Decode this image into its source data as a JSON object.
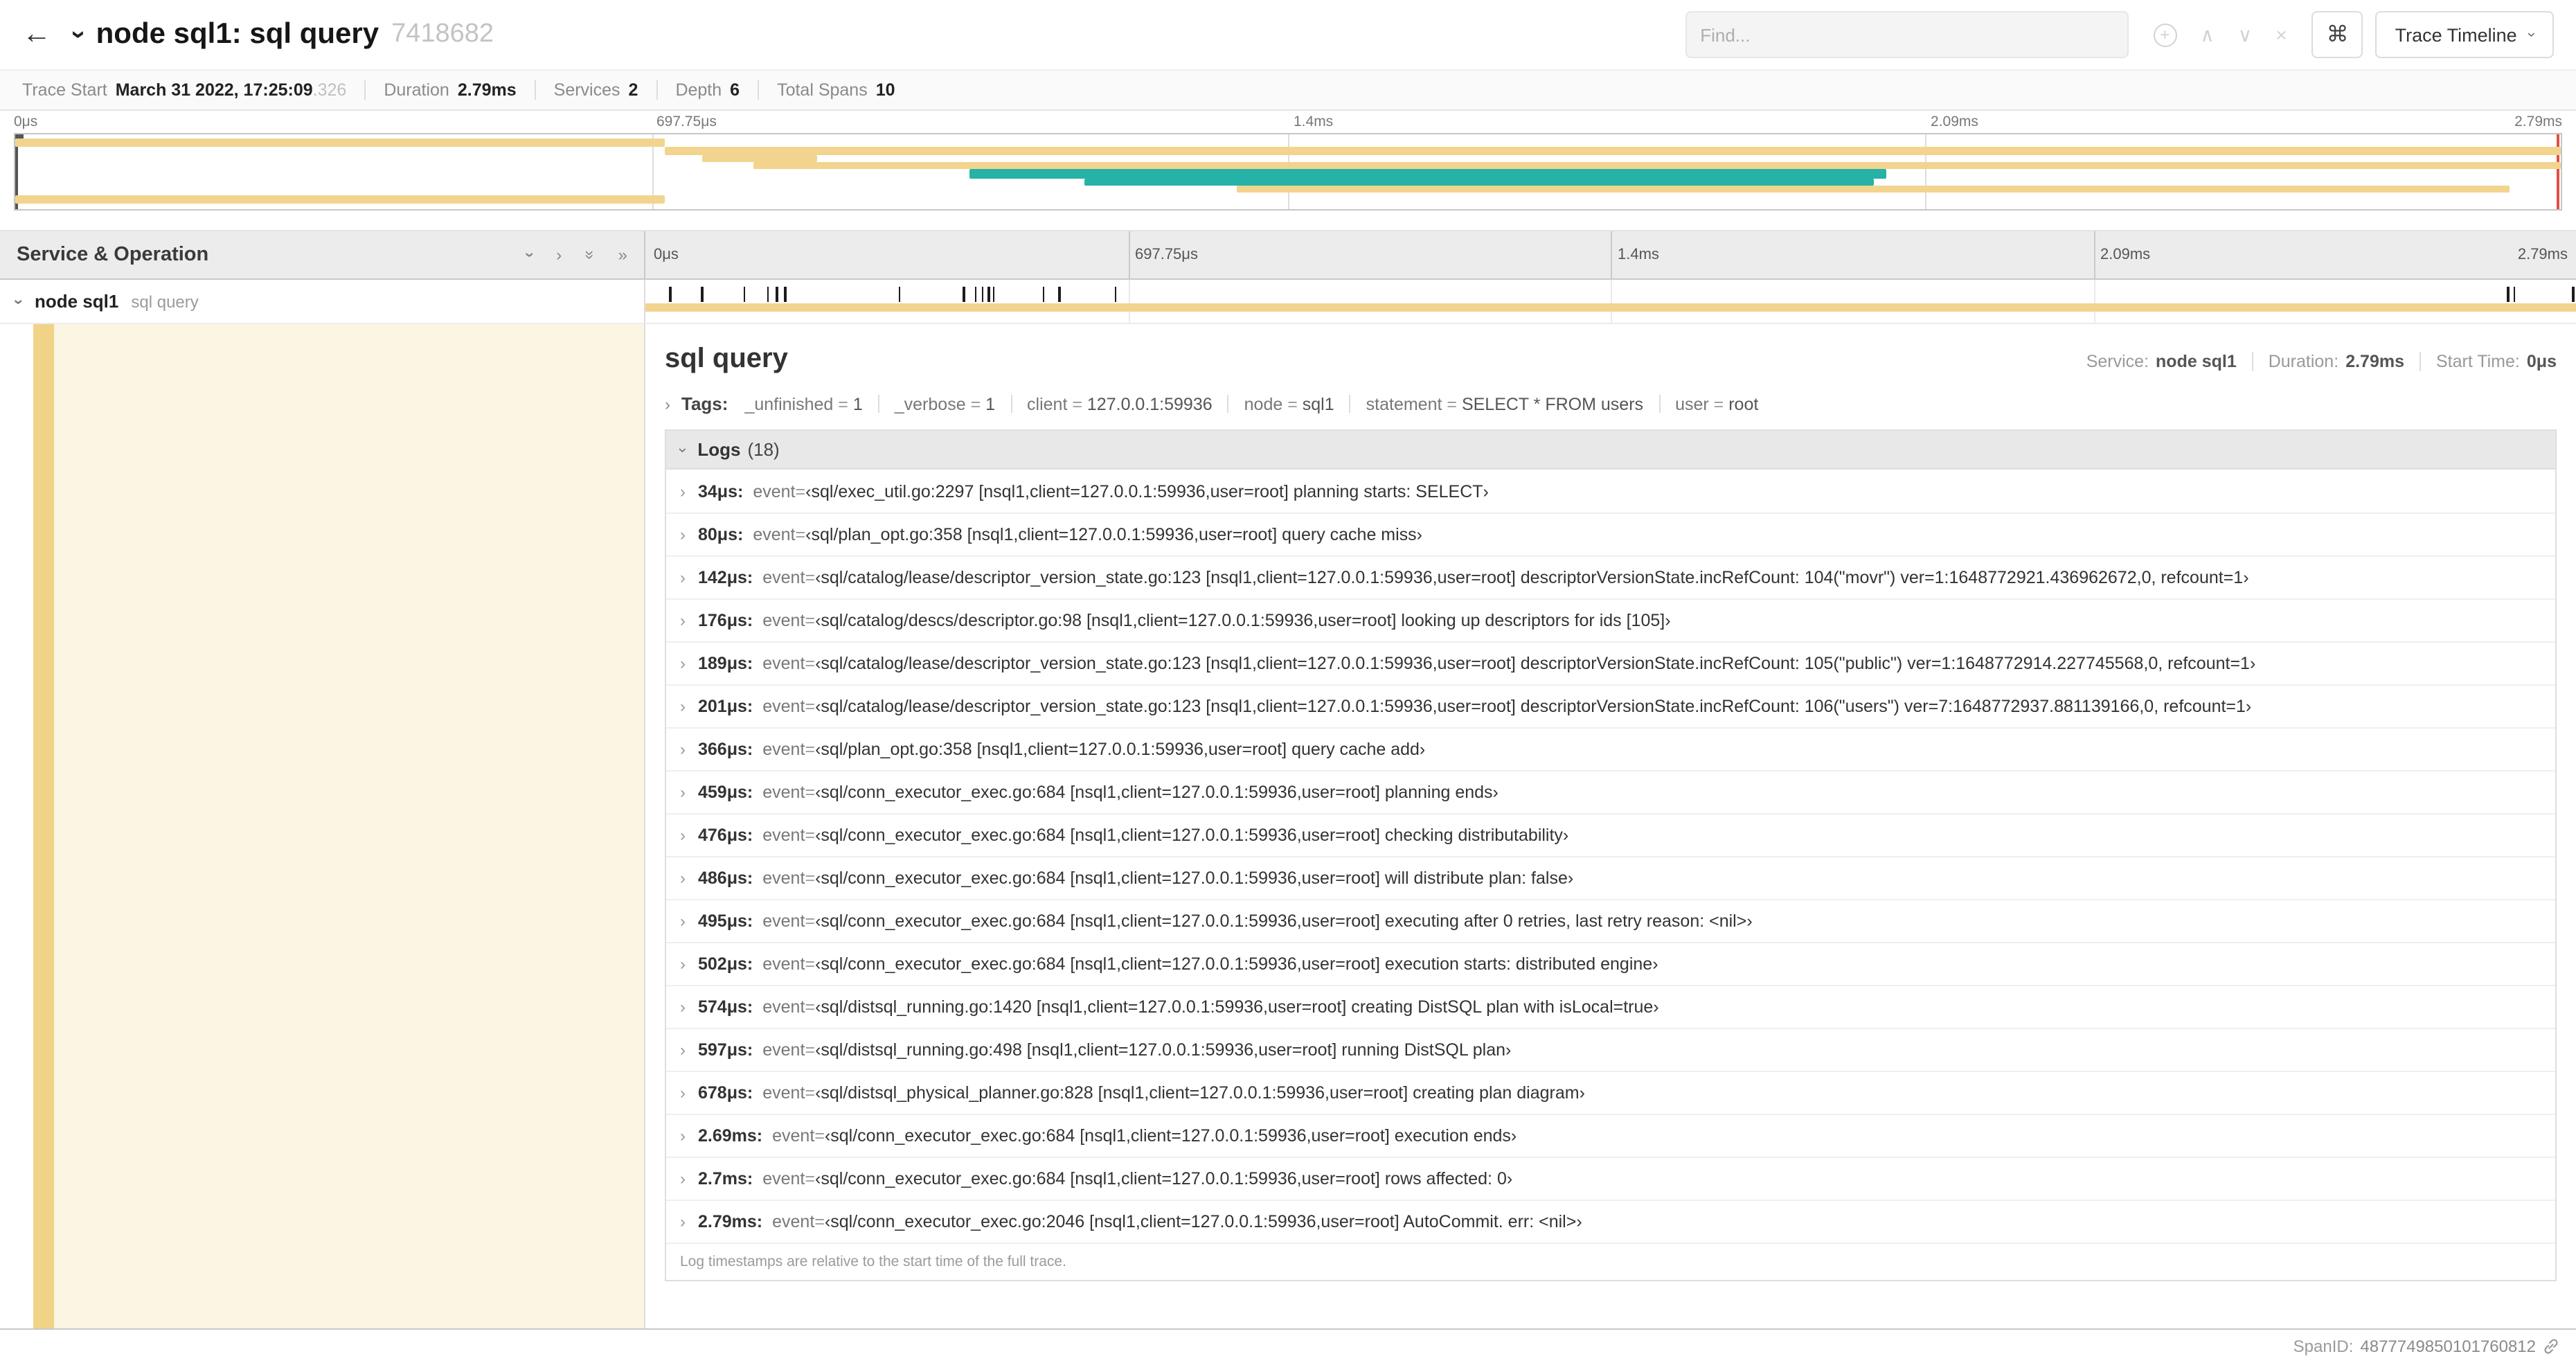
{
  "colors": {
    "tan": "#f2d48f",
    "teal": "#26b2a6",
    "stripe": "#f0d387",
    "cream": "#fbf5e3",
    "red": "#e25041"
  },
  "header": {
    "title": "node sql1: sql query",
    "trace_id": "7418682",
    "find_placeholder": "Find...",
    "trace_timeline_label": "Trace Timeline"
  },
  "summary": {
    "items": [
      {
        "label": "Trace Start",
        "value": "March 31 2022, 17:25:09",
        "suffix": ".326"
      },
      {
        "label": "Duration",
        "value": "2.79ms"
      },
      {
        "label": "Services",
        "value": "2"
      },
      {
        "label": "Depth",
        "value": "6"
      },
      {
        "label": "Total Spans",
        "value": "10"
      }
    ]
  },
  "minimap": {
    "ticks": [
      "0μs",
      "697.75μs",
      "1.4ms",
      "2.09ms",
      "2.79ms"
    ],
    "bars": [
      {
        "l": 0,
        "w": 25.5,
        "t": 3,
        "h": 6,
        "c": "tan"
      },
      {
        "l": 25.5,
        "w": 74.5,
        "t": 9,
        "h": 6,
        "c": "tan"
      },
      {
        "l": 27,
        "w": 4.5,
        "t": 15,
        "h": 5,
        "c": "tan"
      },
      {
        "l": 29,
        "w": 71,
        "t": 20,
        "h": 5,
        "c": "tan"
      },
      {
        "l": 37.5,
        "w": 36,
        "t": 25,
        "h": 7,
        "c": "teal"
      },
      {
        "l": 42,
        "w": 31,
        "t": 32,
        "h": 5,
        "c": "teal"
      },
      {
        "l": 48,
        "w": 50,
        "t": 37,
        "h": 5,
        "c": "tan"
      },
      {
        "l": 0,
        "w": 25.5,
        "t": 44,
        "h": 6,
        "c": "tan"
      }
    ]
  },
  "timeline": {
    "left_header": "Service & Operation",
    "ticks": [
      "0μs",
      "697.75μs",
      "1.4ms",
      "2.09ms",
      "2.79ms"
    ],
    "row": {
      "service": "node sql1",
      "operation": "sql query",
      "log_tick_percents": [
        1.22,
        2.87,
        5.09,
        6.31,
        6.77,
        7.2,
        13.12,
        16.45,
        17.06,
        17.42,
        17.74,
        17.99,
        20.57,
        21.4,
        24.3,
        96.42,
        96.77,
        99.8
      ]
    }
  },
  "detail": {
    "title": "sql query",
    "service_label": "Service:",
    "service": "node sql1",
    "duration_label": "Duration:",
    "duration": "2.79ms",
    "start_label": "Start Time:",
    "start": "0μs",
    "tags_label": "Tags:",
    "tags": [
      {
        "key": "_unfinished",
        "value": "1"
      },
      {
        "key": "_verbose",
        "value": "1"
      },
      {
        "key": "client",
        "value": "127.0.0.1:59936"
      },
      {
        "key": "node",
        "value": "sql1"
      },
      {
        "key": "statement",
        "value": "SELECT * FROM users"
      },
      {
        "key": "user",
        "value": "root"
      }
    ],
    "logs_label": "Logs",
    "logs_count": "(18)",
    "logs": [
      {
        "time": "34μs:",
        "key": "event",
        "value": "‹sql/exec_util.go:2297 [nsql1,client=127.0.0.1:59936,user=root] planning starts: SELECT›"
      },
      {
        "time": "80μs:",
        "key": "event",
        "value": "‹sql/plan_opt.go:358 [nsql1,client=127.0.0.1:59936,user=root] query cache miss›"
      },
      {
        "time": "142μs:",
        "key": "event",
        "value": "‹sql/catalog/lease/descriptor_version_state.go:123 [nsql1,client=127.0.0.1:59936,user=root] descriptorVersionState.incRefCount: 104(\"movr\") ver=1:1648772921.436962672,0, refcount=1›"
      },
      {
        "time": "176μs:",
        "key": "event",
        "value": "‹sql/catalog/descs/descriptor.go:98 [nsql1,client=127.0.0.1:59936,user=root] looking up descriptors for ids [105]›"
      },
      {
        "time": "189μs:",
        "key": "event",
        "value": "‹sql/catalog/lease/descriptor_version_state.go:123 [nsql1,client=127.0.0.1:59936,user=root] descriptorVersionState.incRefCount: 105(\"public\") ver=1:1648772914.227745568,0, refcount=1›"
      },
      {
        "time": "201μs:",
        "key": "event",
        "value": "‹sql/catalog/lease/descriptor_version_state.go:123 [nsql1,client=127.0.0.1:59936,user=root] descriptorVersionState.incRefCount: 106(\"users\") ver=7:1648772937.881139166,0, refcount=1›"
      },
      {
        "time": "366μs:",
        "key": "event",
        "value": "‹sql/plan_opt.go:358 [nsql1,client=127.0.0.1:59936,user=root] query cache add›"
      },
      {
        "time": "459μs:",
        "key": "event",
        "value": "‹sql/conn_executor_exec.go:684 [nsql1,client=127.0.0.1:59936,user=root] planning ends›"
      },
      {
        "time": "476μs:",
        "key": "event",
        "value": "‹sql/conn_executor_exec.go:684 [nsql1,client=127.0.0.1:59936,user=root] checking distributability›"
      },
      {
        "time": "486μs:",
        "key": "event",
        "value": "‹sql/conn_executor_exec.go:684 [nsql1,client=127.0.0.1:59936,user=root] will distribute plan: false›"
      },
      {
        "time": "495μs:",
        "key": "event",
        "value": "‹sql/conn_executor_exec.go:684 [nsql1,client=127.0.0.1:59936,user=root] executing after 0 retries, last retry reason: <nil>›"
      },
      {
        "time": "502μs:",
        "key": "event",
        "value": "‹sql/conn_executor_exec.go:684 [nsql1,client=127.0.0.1:59936,user=root] execution starts: distributed engine›"
      },
      {
        "time": "574μs:",
        "key": "event",
        "value": "‹sql/distsql_running.go:1420 [nsql1,client=127.0.0.1:59936,user=root] creating DistSQL plan with isLocal=true›"
      },
      {
        "time": "597μs:",
        "key": "event",
        "value": "‹sql/distsql_running.go:498 [nsql1,client=127.0.0.1:59936,user=root] running DistSQL plan›"
      },
      {
        "time": "678μs:",
        "key": "event",
        "value": "‹sql/distsql_physical_planner.go:828 [nsql1,client=127.0.0.1:59936,user=root] creating plan diagram›"
      },
      {
        "time": "2.69ms:",
        "key": "event",
        "value": "‹sql/conn_executor_exec.go:684 [nsql1,client=127.0.0.1:59936,user=root] execution ends›"
      },
      {
        "time": "2.7ms:",
        "key": "event",
        "value": "‹sql/conn_executor_exec.go:684 [nsql1,client=127.0.0.1:59936,user=root] rows affected: 0›"
      },
      {
        "time": "2.79ms:",
        "key": "event",
        "value": "‹sql/conn_executor_exec.go:2046 [nsql1,client=127.0.0.1:59936,user=root] AutoCommit. err: <nil>›"
      }
    ],
    "footer": "Log timestamps are relative to the start time of the full trace.",
    "span_id_label": "SpanID:",
    "span_id": "4877749850101760812"
  }
}
